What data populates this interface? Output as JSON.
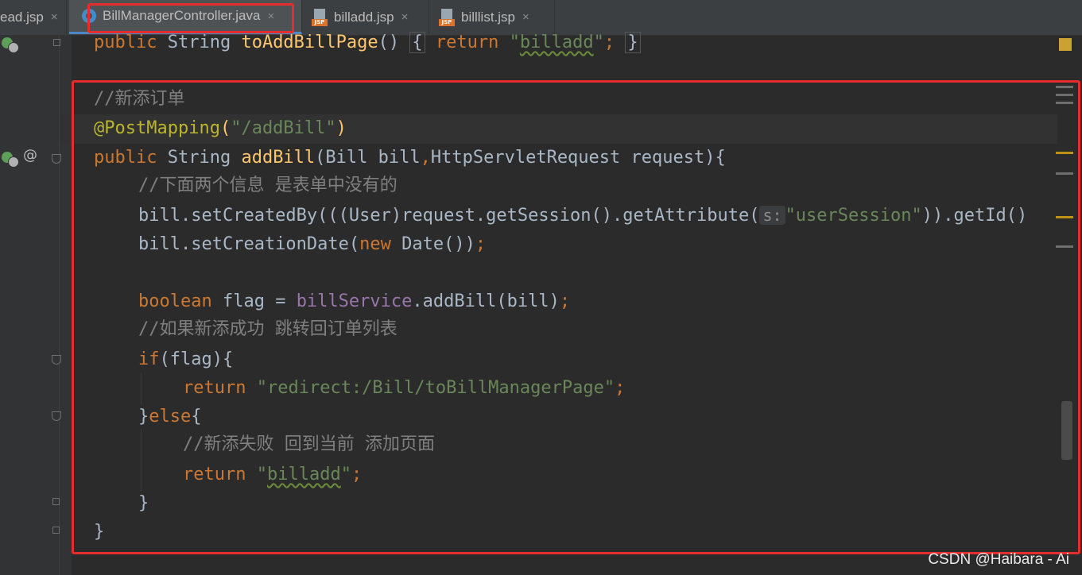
{
  "tabs": [
    {
      "label": "ead.jsp",
      "icon": "none",
      "active": false
    },
    {
      "label": "BillManagerController.java",
      "icon": "java-class-icon",
      "active": true
    },
    {
      "label": "billadd.jsp",
      "icon": "jsp-file-icon",
      "active": false
    },
    {
      "label": "billlist.jsp",
      "icon": "jsp-file-icon",
      "active": false
    }
  ],
  "close_glyph": "×",
  "jsp_tag": "JSP",
  "gutter": {
    "at_glyph": "@"
  },
  "code": {
    "l1": {
      "kw": "public",
      "type": " String ",
      "fn": "toAddBillPage",
      "rest": "() ",
      "ob": "{",
      "sp": " ",
      "ret": "return",
      "q1": " \"",
      "strw": "billadd",
      "q2": "\"",
      "semi": ";",
      "sp2": " ",
      "cb": "}"
    },
    "l2": {
      "cmt": "//新添订单"
    },
    "l3": {
      "ann": "@PostMapping",
      "p1": "(",
      "str": "\"/addBill\"",
      "p2": ")"
    },
    "l4": {
      "kw": "public",
      "type": " String ",
      "fn": "addBill",
      "rest": "(Bill bill",
      "comma": ",",
      "rest2": "HttpServletRequest request){"
    },
    "l5": {
      "cmt": "//下面两个信息 是表单中没有的"
    },
    "l6": {
      "pre": "bill.setCreatedBy(((User)request.getSession().getAttribute(",
      "hint": "s:",
      "str": "\"userSession\"",
      "post": ")).getId()"
    },
    "l7": {
      "pre": "bill.setCreationDate(",
      "kw": "new",
      "post": " Date())",
      "semi": ";"
    },
    "l8": {
      "kw": "boolean",
      "mid": " flag = ",
      "fld": "billService",
      "post": ".addBill(bill)",
      "semi": ";"
    },
    "l9": {
      "cmt": "//如果新添成功 跳转回订单列表"
    },
    "l10": {
      "kw": "if",
      "post": "(flag){"
    },
    "l11": {
      "kw": "return",
      "str": " \"redirect:/Bill/toBillManagerPage\"",
      "semi": ";"
    },
    "l12": {
      "pre": "}",
      "kw": "else",
      "post": "{"
    },
    "l13": {
      "cmt": "//新添失败 回到当前 添加页面"
    },
    "l14": {
      "kw": "return",
      "q1": " \"",
      "strw": "billadd",
      "q2": "\"",
      "semi": ";"
    },
    "l15": {
      "text": "}"
    },
    "l16": {
      "text": "}"
    }
  },
  "watermark": "CSDN @Haibara - Ai",
  "colors": {
    "keyword": "#cc7832",
    "string": "#6a8759",
    "annotation": "#bbb529",
    "comment": "#808080",
    "method": "#ffc66d",
    "field": "#9876aa",
    "highlight": "#e52d2d"
  }
}
